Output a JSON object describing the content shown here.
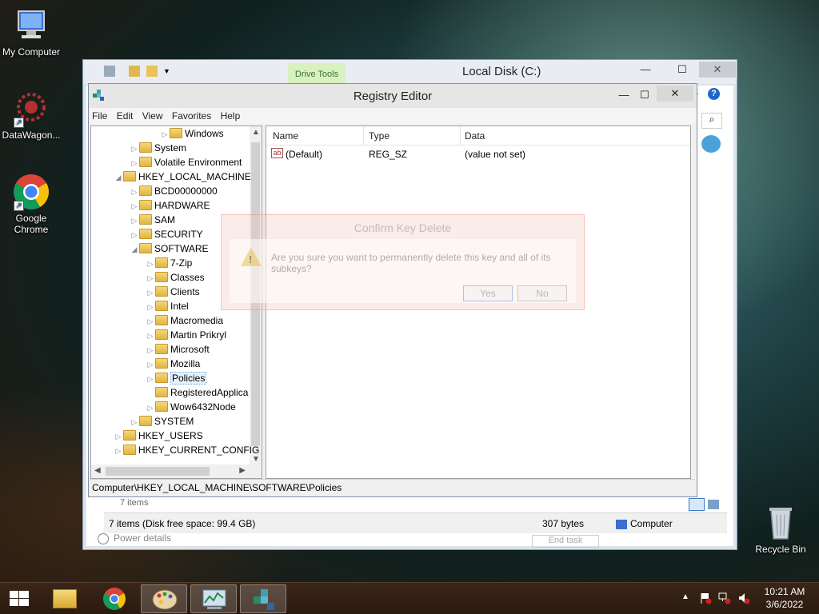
{
  "desktop": {
    "icons": [
      {
        "label": "My Computer"
      },
      {
        "label": "DataWagon..."
      },
      {
        "label": "Google Chrome"
      },
      {
        "label": "Recycle Bin"
      }
    ]
  },
  "explorer": {
    "title": "Local Disk (C:)",
    "ribbon_tab": "Drive Tools",
    "items_count": "7 items",
    "status_items": "7 items (Disk free space: 99.4 GB)",
    "status_size": "307 bytes",
    "status_location": "Computer",
    "power_details": "Power details",
    "end_task": "End task",
    "minimize": "—",
    "maximize": "☐",
    "close": "✕"
  },
  "regedit": {
    "title": "Registry Editor",
    "menu": [
      "File",
      "Edit",
      "View",
      "Favorites",
      "Help"
    ],
    "tree": [
      {
        "label": "Windows",
        "depth": 3
      },
      {
        "label": "System",
        "depth": 2
      },
      {
        "label": "Volatile Environment",
        "depth": 2
      },
      {
        "label": "HKEY_LOCAL_MACHINE",
        "depth": 1
      },
      {
        "label": "BCD00000000",
        "depth": 2
      },
      {
        "label": "HARDWARE",
        "depth": 2
      },
      {
        "label": "SAM",
        "depth": 2
      },
      {
        "label": "SECURITY",
        "depth": 2
      },
      {
        "label": "SOFTWARE",
        "depth": 2
      },
      {
        "label": "7-Zip",
        "depth": 3
      },
      {
        "label": "Classes",
        "depth": 3
      },
      {
        "label": "Clients",
        "depth": 3
      },
      {
        "label": "Intel",
        "depth": 3
      },
      {
        "label": "Macromedia",
        "depth": 3
      },
      {
        "label": "Martin Prikryl",
        "depth": 3
      },
      {
        "label": "Microsoft",
        "depth": 3
      },
      {
        "label": "Mozilla",
        "depth": 3
      },
      {
        "label": "Policies",
        "depth": 3
      },
      {
        "label": "RegisteredApplica",
        "depth": 3
      },
      {
        "label": "Wow6432Node",
        "depth": 3
      },
      {
        "label": "SYSTEM",
        "depth": 2
      },
      {
        "label": "HKEY_USERS",
        "depth": 1
      },
      {
        "label": "HKEY_CURRENT_CONFIG",
        "depth": 1
      }
    ],
    "columns": [
      "Name",
      "Type",
      "Data"
    ],
    "rows": [
      {
        "name": "(Default)",
        "type": "REG_SZ",
        "data": "(value not set)"
      }
    ],
    "value_icon": "ab",
    "status_path": "Computer\\HKEY_LOCAL_MACHINE\\SOFTWARE\\Policies"
  },
  "dialog": {
    "title": "Confirm Key Delete",
    "message": "Are you sure you want to permanently delete this key and all of its subkeys?",
    "yes": "Yes",
    "no": "No",
    "warn_symbol": "!"
  },
  "taskbar": {
    "time": "10:21 AM",
    "date": "3/6/2022",
    "apps": [
      "file-explorer",
      "google-chrome",
      "paint",
      "task-manager",
      "registry-editor"
    ]
  }
}
